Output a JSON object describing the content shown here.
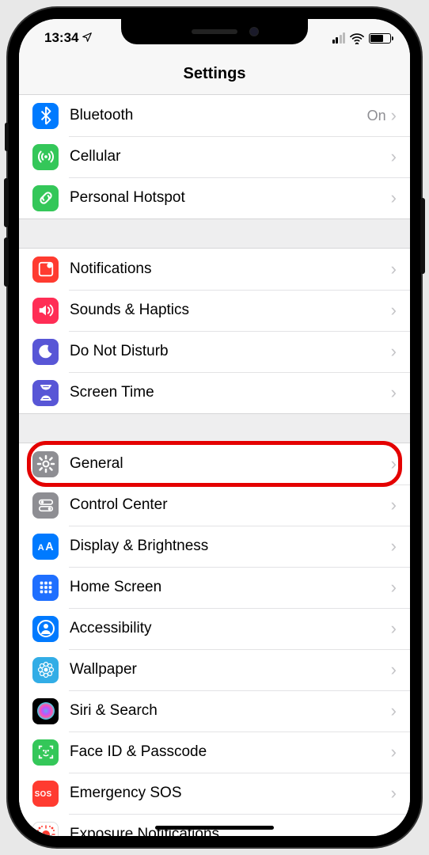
{
  "status": {
    "time": "13:34",
    "battery_pct": 55
  },
  "header": {
    "title": "Settings"
  },
  "groups": [
    {
      "rows": [
        {
          "key": "bluetooth",
          "label": "Bluetooth",
          "value": "On",
          "icon": "bluetooth-icon",
          "bg": "bg-blue"
        },
        {
          "key": "cellular",
          "label": "Cellular",
          "icon": "antenna-icon",
          "bg": "bg-green"
        },
        {
          "key": "hotspot",
          "label": "Personal Hotspot",
          "icon": "chain-icon",
          "bg": "bg-green"
        }
      ]
    },
    {
      "rows": [
        {
          "key": "notifications",
          "label": "Notifications",
          "icon": "bell-square-icon",
          "bg": "bg-red"
        },
        {
          "key": "sounds",
          "label": "Sounds & Haptics",
          "icon": "speaker-icon",
          "bg": "bg-pink"
        },
        {
          "key": "dnd",
          "label": "Do Not Disturb",
          "icon": "moon-icon",
          "bg": "bg-purple"
        },
        {
          "key": "screentime",
          "label": "Screen Time",
          "icon": "hourglass-icon",
          "bg": "bg-purple"
        }
      ]
    },
    {
      "rows": [
        {
          "key": "general",
          "label": "General",
          "icon": "gear-icon",
          "bg": "bg-gray",
          "highlight": true
        },
        {
          "key": "controlcenter",
          "label": "Control Center",
          "icon": "switches-icon",
          "bg": "bg-gray"
        },
        {
          "key": "display",
          "label": "Display & Brightness",
          "icon": "aa-icon",
          "bg": "bg-blue"
        },
        {
          "key": "homescreen",
          "label": "Home Screen",
          "icon": "grid-icon",
          "bg": "bg-blueDeep"
        },
        {
          "key": "accessibility",
          "label": "Accessibility",
          "icon": "person-circle-icon",
          "bg": "bg-blue"
        },
        {
          "key": "wallpaper",
          "label": "Wallpaper",
          "icon": "flower-icon",
          "bg": "bg-cyan"
        },
        {
          "key": "siri",
          "label": "Siri & Search",
          "icon": "siri-icon",
          "bg": "bg-black"
        },
        {
          "key": "faceid",
          "label": "Face ID & Passcode",
          "icon": "faceid-icon",
          "bg": "bg-green"
        },
        {
          "key": "sos",
          "label": "Emergency SOS",
          "icon": "sos-icon",
          "bg": "bg-red"
        },
        {
          "key": "exposure",
          "label": "Exposure Notifications",
          "icon": "exposure-icon",
          "bg": "bg-white"
        }
      ]
    }
  ]
}
